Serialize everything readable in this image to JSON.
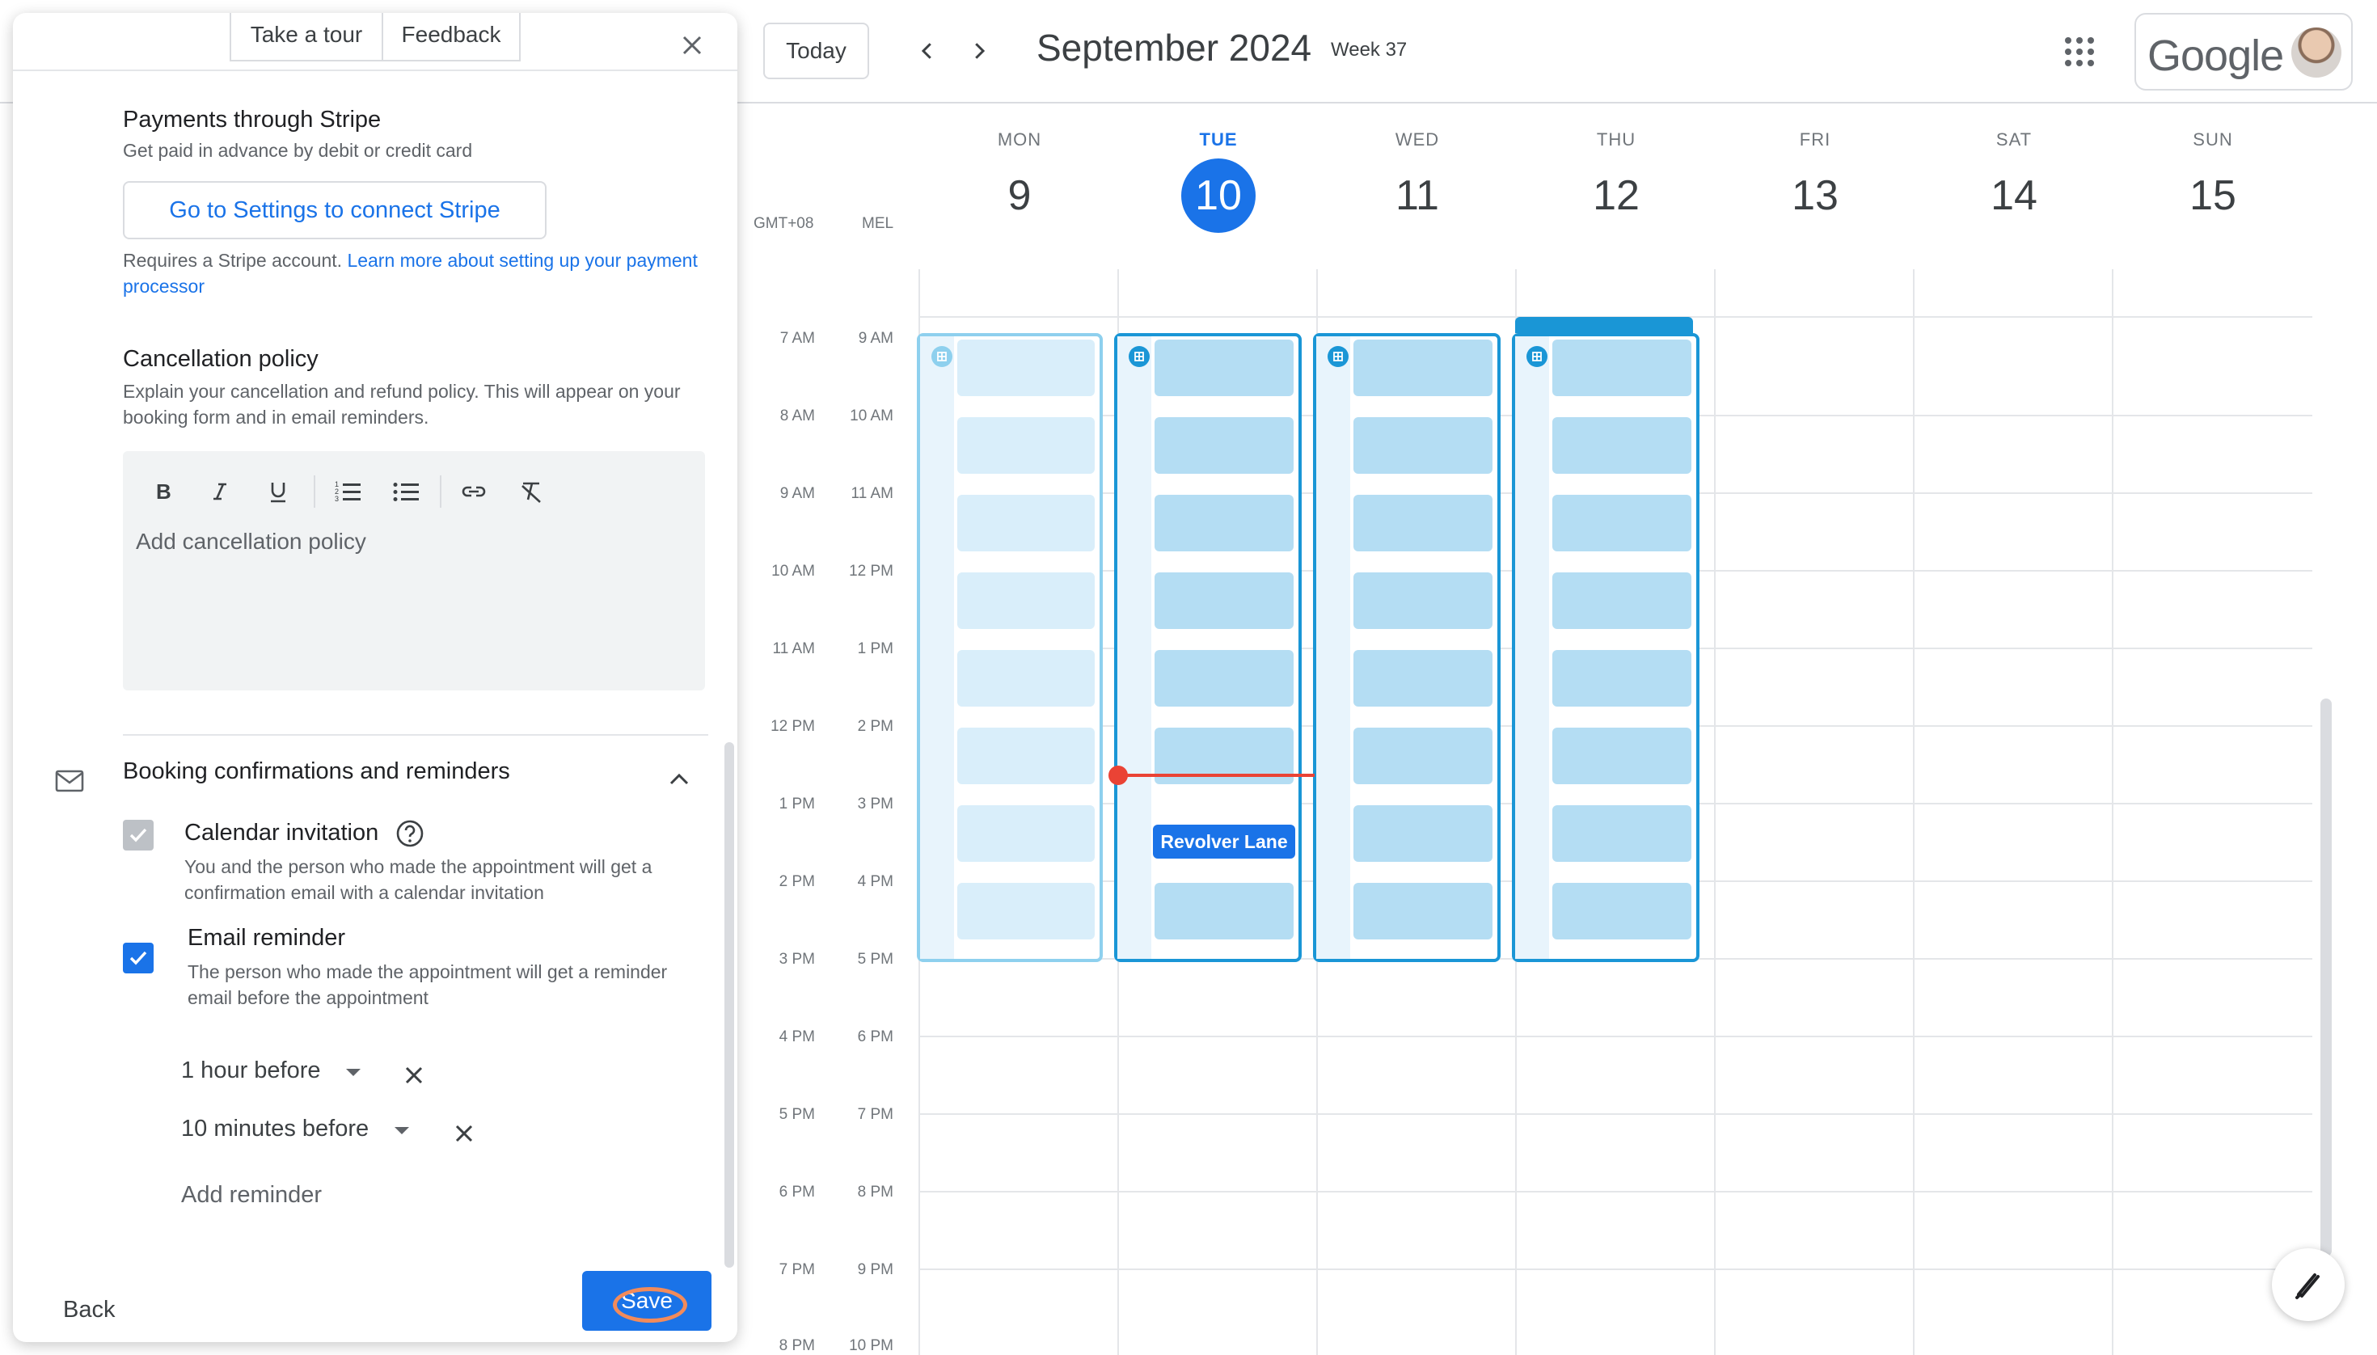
{
  "header": {
    "today_label": "Today",
    "month_title": "September 2024",
    "week_badge": "Week 37",
    "brand": "Google"
  },
  "calendar": {
    "timezones": [
      "GMT+08",
      "MEL"
    ],
    "days": [
      {
        "name": "MON",
        "num": "9"
      },
      {
        "name": "TUE",
        "num": "10",
        "today": true
      },
      {
        "name": "WED",
        "num": "11"
      },
      {
        "name": "THU",
        "num": "12"
      },
      {
        "name": "FRI",
        "num": "13"
      },
      {
        "name": "SAT",
        "num": "14"
      },
      {
        "name": "SUN",
        "num": "15"
      }
    ],
    "times_primary": [
      "7 AM",
      "8 AM",
      "9 AM",
      "10 AM",
      "11 AM",
      "12 PM",
      "1 PM",
      "2 PM",
      "3 PM",
      "4 PM",
      "5 PM",
      "6 PM",
      "7 PM",
      "8 PM"
    ],
    "times_secondary": [
      "9 AM",
      "10 AM",
      "11 AM",
      "12 PM",
      "1 PM",
      "2 PM",
      "3 PM",
      "4 PM",
      "5 PM",
      "6 PM",
      "7 PM",
      "8 PM",
      "9 PM",
      "10 PM"
    ],
    "event_label": "Revolver Lane"
  },
  "panel": {
    "tour_label": "Take a tour",
    "feedback_label": "Feedback",
    "payments": {
      "title": "Payments through Stripe",
      "subtitle": "Get paid in advance by debit or credit card",
      "button": "Go to Settings to connect Stripe",
      "note": "Requires a Stripe account.",
      "link": "Learn more about setting up your payment processor"
    },
    "cancellation": {
      "title": "Cancellation policy",
      "subtitle": "Explain your cancellation and refund policy. This will appear on your booking form and in email reminders.",
      "placeholder": "Add cancellation policy"
    },
    "confirmations": {
      "title": "Booking confirmations and reminders",
      "calendar_invitation": {
        "label": "Calendar invitation",
        "desc": "You and the person who made the appointment will get a confirmation email with a calendar invitation",
        "checked": true
      },
      "email_reminder": {
        "label": "Email reminder",
        "desc": "The person who made the appointment will get a reminder email before the appointment",
        "checked": true
      },
      "reminders": [
        "1 hour before",
        "10 minutes before"
      ],
      "add_label": "Add reminder"
    },
    "back_label": "Back",
    "save_label": "Save"
  },
  "icons": {
    "close": "close-icon",
    "apps": "apps-grid-icon",
    "mail": "mail-icon",
    "help": "help-circle-icon",
    "brand_accent": "#1a73e8",
    "availability": "#1a96d6",
    "now_indicator": "#ea4335"
  }
}
